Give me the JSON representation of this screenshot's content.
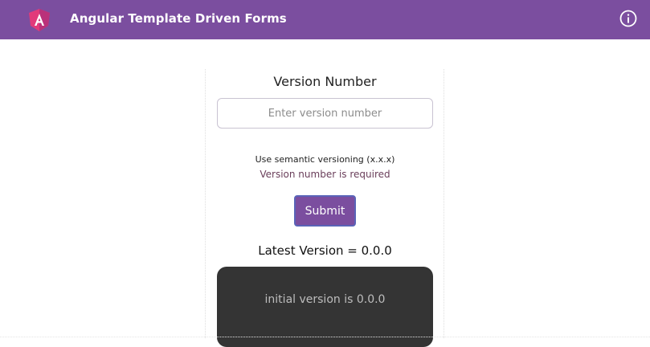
{
  "header": {
    "title": "Angular Template Driven Forms",
    "logo_icon": "angular-logo-icon",
    "info_icon": "info-icon",
    "background": "#7b4e9f"
  },
  "form": {
    "label": "Version Number",
    "input_value": "",
    "input_placeholder": "Enter version number",
    "hint": "Use semantic versioning (x.x.x)",
    "error": "Version number is required",
    "submit_label": "Submit"
  },
  "latest": {
    "text": "Latest Version = 0.0.0"
  },
  "panel": {
    "text": "initial version is 0.0.0",
    "background": "#343434"
  }
}
